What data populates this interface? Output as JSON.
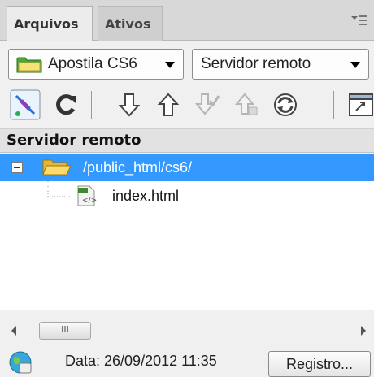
{
  "tabs": [
    {
      "label": "Arquivos",
      "active": true
    },
    {
      "label": "Ativos",
      "active": false
    }
  ],
  "site_select": {
    "value": "Apostila CS6",
    "icon": "folder-icon"
  },
  "view_select": {
    "value": "Servidor remoto"
  },
  "toolbar": {
    "buttons": [
      "connect-icon",
      "refresh-icon",
      "get-icon",
      "put-icon",
      "check-out-icon",
      "check-in-icon",
      "synchronize-icon",
      "expand-icon"
    ]
  },
  "section": {
    "title": "Servidor remoto"
  },
  "tree": {
    "root": {
      "label": "/public_html/cs6/",
      "expanded": true,
      "selected": true
    },
    "children": [
      {
        "label": "index.html",
        "icon": "html-file-icon"
      }
    ]
  },
  "scrollbar": {
    "thumb_glyph": "III"
  },
  "status": {
    "text": "Data: 26/09/2012 11:35",
    "log_button": "Registro..."
  },
  "colors": {
    "selection": "#3399ff",
    "panel_bg": "#f0f0f0",
    "tab_bar": "#d8d8d8"
  }
}
